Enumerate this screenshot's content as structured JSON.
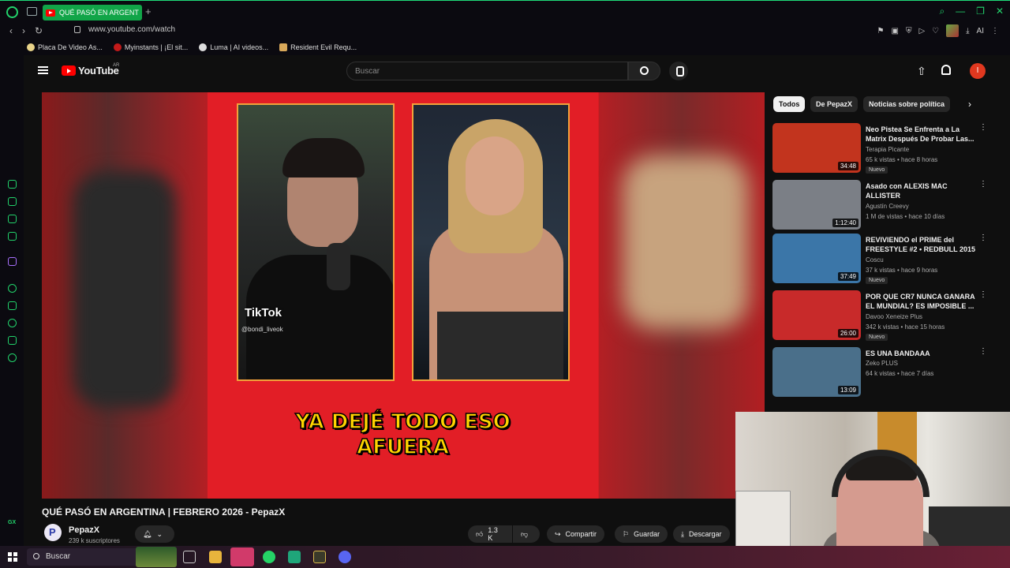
{
  "browser": {
    "tab_title": "QUÉ PASÓ EN ARGENT",
    "new_tab": "+",
    "url": "www.youtube.com/watch",
    "bookmarks": [
      "Placa De Video As...",
      "Myinstants | ¡El sit...",
      "Luma | AI  videos...",
      "Resident Evil Requ..."
    ],
    "sidebar_label": "GX",
    "ext_ai": "AI"
  },
  "youtube": {
    "logo_text": "YouTube",
    "country": "AR",
    "search_placeholder": "Buscar",
    "avatar_letter": "I"
  },
  "video": {
    "overlay_app": "TikTok",
    "overlay_user": "@bondi_liveok",
    "caption_line1": "YA DEJÉ TODO ESO",
    "caption_line2": "AFUERA",
    "title": "QUÉ PASÓ EN ARGENTINA | FEBRERO 2026 - PepazX",
    "channel": "PepazX",
    "subscribers": "239 k suscriptores",
    "likes": "1.3 K",
    "share": "Compartir",
    "save": "Guardar",
    "download": "Descargar"
  },
  "chips": [
    "Todos",
    "De PepazX",
    "Noticias sobre política"
  ],
  "recommendations": [
    {
      "title": "Neo Pistea Se Enfrenta a La Matrix Después De Probar Las...",
      "channel": "Terapia Picante",
      "meta": "65 k vistas • hace 8 horas",
      "duration": "34:48",
      "badge": "Nuevo",
      "thumb_color": "#c2341e"
    },
    {
      "title": "Asado con ALEXIS MAC ALLISTER",
      "channel": "Agustín Creevy",
      "meta": "1 M de vistas • hace 10 días",
      "duration": "1:12:40",
      "badge": "",
      "thumb_color": "#7b7f86"
    },
    {
      "title": "REVIVIENDO el PRIME del FREESTYLE #2 • REDBULL 2015",
      "channel": "Coscu",
      "meta": "37 k vistas • hace 9 horas",
      "duration": "37:49",
      "badge": "Nuevo",
      "thumb_color": "#3b76a8"
    },
    {
      "title": "POR QUE CR7 NUNCA GANARA EL MUNDIAL? ES IMPOSIBLE ...",
      "channel": "Davoo Xeneize Plus",
      "meta": "342 k vistas • hace 15 horas",
      "duration": "26:00",
      "badge": "Nuevo",
      "thumb_color": "#c82a2a"
    },
    {
      "title": "ES UNA BANDAAA",
      "channel": "Zeko PLUS",
      "meta": "64 k vistas • hace 7 días",
      "duration": "13:09",
      "badge": "",
      "thumb_color": "#4a6f8a"
    }
  ],
  "taskbar": {
    "search": "Buscar"
  }
}
